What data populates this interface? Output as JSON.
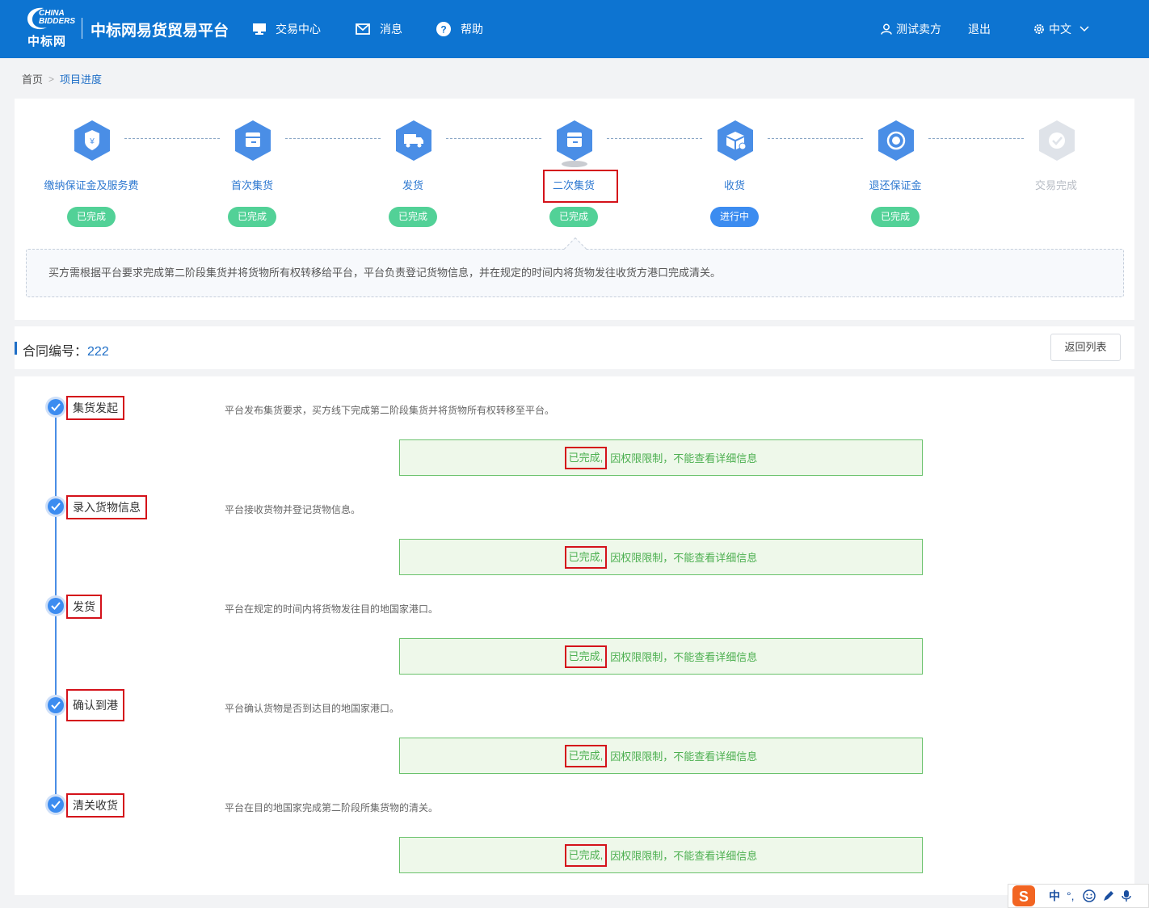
{
  "header": {
    "logo_en": "CHINA BIDDERS",
    "logo_cn": "中标网",
    "site_title": "中标网易货贸易平台",
    "nav": {
      "trade_center": "交易中心",
      "messages": "消息",
      "help": "帮助",
      "user": "测试卖方",
      "logout": "退出",
      "language": "中文"
    }
  },
  "breadcrumb": {
    "home": "首页",
    "current": "项目进度"
  },
  "steps": [
    {
      "name": "缴纳保证金及服务费",
      "status": "已完成",
      "icon": "shield-yen-icon"
    },
    {
      "name": "首次集货",
      "status": "已完成",
      "icon": "box-icon"
    },
    {
      "name": "发货",
      "status": "已完成",
      "icon": "truck-icon"
    },
    {
      "name": "二次集货",
      "status": "已完成",
      "icon": "box-icon"
    },
    {
      "name": "收货",
      "status": "进行中",
      "icon": "receive-box-icon"
    },
    {
      "name": "退还保证金",
      "status": "已完成",
      "icon": "refund-icon"
    },
    {
      "name": "交易完成",
      "status": "",
      "icon": "check-icon"
    }
  ],
  "step_description": "买方需根据平台要求完成第二阶段集货并将货物所有权转移给平台，平台负责登记货物信息，并在规定的时间内将货物发往收货方港口完成清关。",
  "contract": {
    "label": "合同编号：",
    "number": "222",
    "back_button": "返回列表"
  },
  "timeline": [
    {
      "title": "集货发起",
      "desc": "平台发布集货要求，买方线下完成第二阶段集货并将货物所有权转移至平台。",
      "done": "已完成,",
      "note": "因权限限制，不能查看详细信息"
    },
    {
      "title": "录入货物信息",
      "desc": "平台接收货物并登记货物信息。",
      "done": "已完成,",
      "note": "因权限限制，不能查看详细信息"
    },
    {
      "title": "发货",
      "desc": "平台在规定的时间内将货物发往目的地国家港口。",
      "done": "已完成,",
      "note": "因权限限制，不能查看详细信息"
    },
    {
      "title": "确认到港",
      "desc": "平台确认货物是否到达目的地国家港口。",
      "done": "已完成,",
      "note": "因权限限制，不能查看详细信息"
    },
    {
      "title": "清关收货",
      "desc": "平台在目的地国家完成第二阶段所集货物的清关。",
      "done": "已完成,",
      "note": "因权限限制，不能查看详细信息"
    }
  ],
  "ime": {
    "label": "中"
  },
  "colors": {
    "header": "#0d74d1",
    "done": "#52d197",
    "in_progress": "#3c8cf0",
    "highlight": "#d4121a",
    "success_text": "#4caf50"
  }
}
